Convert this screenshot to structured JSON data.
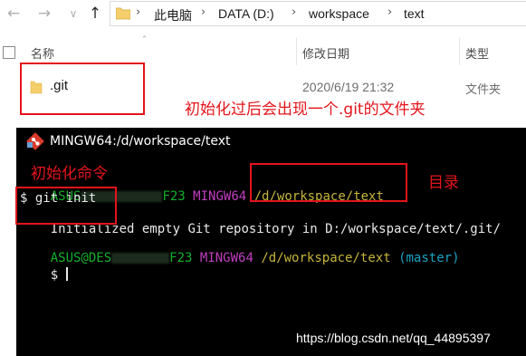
{
  "explorer": {
    "nav": {
      "back_glyph": "←",
      "forward_glyph": "→",
      "dropdown_glyph": "∨",
      "up_glyph": "↑"
    },
    "breadcrumb": {
      "items": [
        "此电脑",
        "DATA (D:)",
        "workspace",
        "text"
      ],
      "separator": "›"
    },
    "columns": {
      "name": "名称",
      "date": "修改日期",
      "type": "类型"
    },
    "files": [
      {
        "name": ".git",
        "date": "2020/6/19 21:32",
        "type": "文件夹",
        "icon": "folder-icon"
      }
    ]
  },
  "annotations": {
    "git_folder_note": "初始化过后会出现一个.git的文件夹",
    "init_command_note": "初始化命令",
    "directory_note": "目录"
  },
  "terminal": {
    "title": "MINGW64:/d/workspace/text",
    "line1": {
      "user_prefix": "ASUS",
      "host_suffix": "F23",
      "shell": "MINGW64",
      "path": "/d/workspace/text"
    },
    "command": "$ git init",
    "output": {
      "part1": "Initialized",
      "part2": " empty Git repository in D:/workspace/text/.git/"
    },
    "line2": {
      "user_prefix": "ASUS@DES",
      "host_suffix": "F23",
      "shell": "MINGW64",
      "path": "/d/workspace/text",
      "branch": "(master)"
    },
    "prompt": "$ "
  },
  "watermark": "https://blog.csdn.net/qq_44895397",
  "colors": {
    "annotation_red": "#e3141b",
    "terminal_bg": "#000000",
    "prompt_green": "#15b02d",
    "shell_magenta": "#c03ec0",
    "path_yellow": "#c7b43b",
    "branch_cyan": "#1aa3c3",
    "folder_yellow": "#f5cf6b"
  }
}
